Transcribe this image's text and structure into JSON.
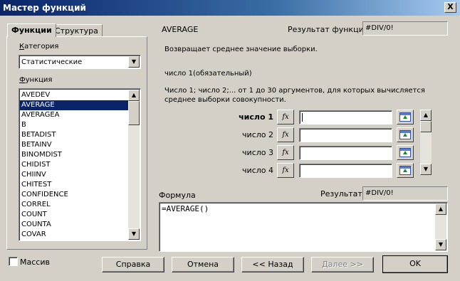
{
  "window": {
    "title": "Мастер функций",
    "close_glyph": "X"
  },
  "tabs": [
    {
      "label": "Функции",
      "active": true
    },
    {
      "label": "Структура",
      "active": false
    }
  ],
  "category": {
    "label": "Категория",
    "value": "Статистические"
  },
  "function_list": {
    "label": "Функция",
    "items": [
      "AVEDEV",
      "AVERAGE",
      "AVERAGEA",
      "B",
      "BETADIST",
      "BETAINV",
      "BINOMDIST",
      "CHIDIST",
      "CHIINV",
      "CHITEST",
      "CONFIDENCE",
      "CORREL",
      "COUNT",
      "COUNTA",
      "COVAR"
    ],
    "selected": "AVERAGE"
  },
  "function_info": {
    "name": "AVERAGE",
    "result_label": "Результат функции",
    "result_value": "#DIV/0!",
    "description": "Возвращает среднее значение выборки.",
    "arg_title": "число 1(обязательный)",
    "arg_desc_line1": "Число 1; число 2;... от 1 до 30 аргументов, для которых вычисляется",
    "arg_desc_line2": "среднее выборки совокупности."
  },
  "arguments": [
    {
      "label": "число 1",
      "value": "",
      "bold": true
    },
    {
      "label": "число 2",
      "value": ""
    },
    {
      "label": "число 3",
      "value": ""
    },
    {
      "label": "число 4",
      "value": ""
    }
  ],
  "fx_glyph": "fx",
  "formula": {
    "label": "Формула",
    "result_label": "Результат",
    "result_value": "#DIV/0!",
    "value": "=AVERAGE()"
  },
  "array_checkbox": {
    "label": "Массив",
    "checked": false
  },
  "buttons": {
    "help": "Справка",
    "cancel": "Отмена",
    "back": "<< Назад",
    "next": "Далее >>",
    "ok": "OK"
  }
}
